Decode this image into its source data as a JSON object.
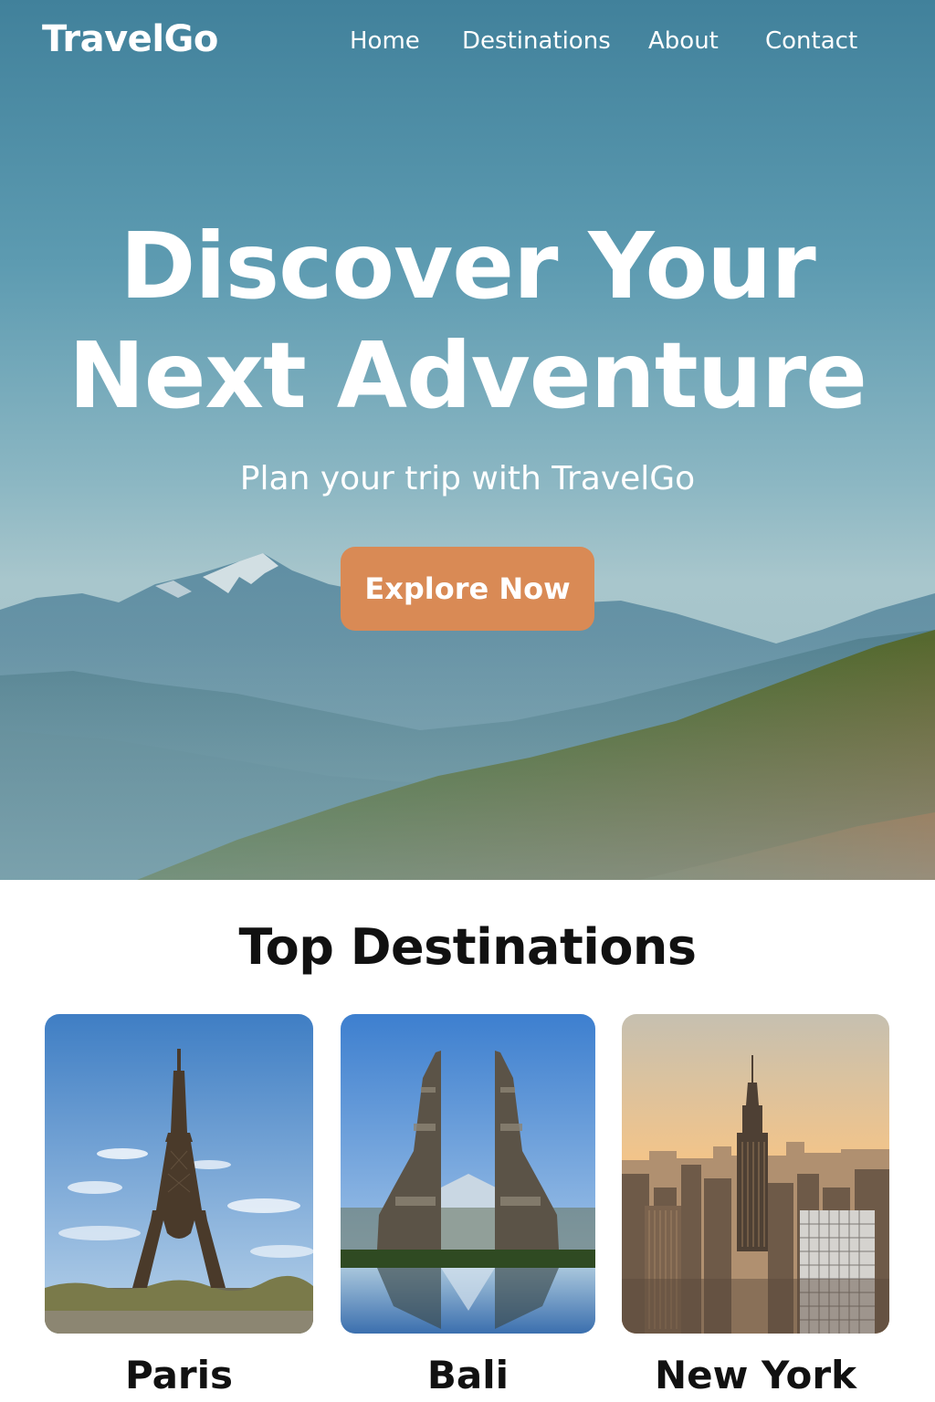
{
  "brand": {
    "name": "TravelGo"
  },
  "nav": {
    "items": [
      {
        "label": "Home"
      },
      {
        "label": "Destinations"
      },
      {
        "label": "About"
      },
      {
        "label": "Contact"
      }
    ]
  },
  "hero": {
    "title_line1": "Discover Your",
    "title_line2": "Next Adventure",
    "subtitle": "Plan your trip with TravelGo",
    "cta_label": "Explore Now"
  },
  "destinations": {
    "title": "Top Destinations",
    "items": [
      {
        "name": "Paris",
        "image": "eiffel-tower-photo"
      },
      {
        "name": "Bali",
        "image": "bali-gate-photo"
      },
      {
        "name": "New York",
        "image": "new-york-skyline-photo"
      }
    ]
  },
  "colors": {
    "cta": "#d98a55",
    "hero_top": "#41819b",
    "text_dark": "#111111"
  }
}
